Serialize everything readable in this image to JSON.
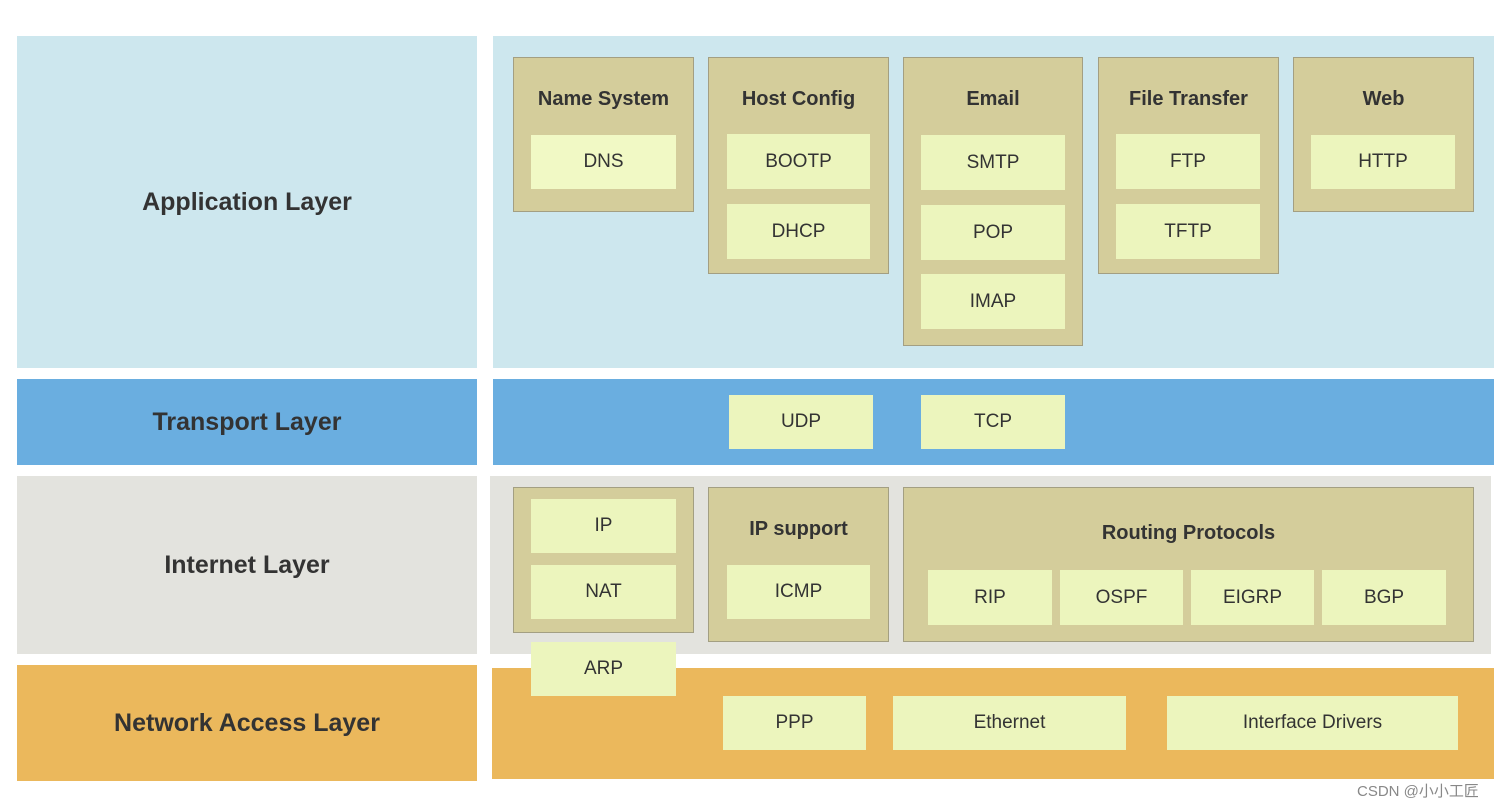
{
  "layers": {
    "application": "Application Layer",
    "transport": "Transport Layer",
    "internet": "Internet Layer",
    "network_access": "Network Access Layer"
  },
  "groups": {
    "name_system": "Name System",
    "host_config": "Host Config",
    "email": "Email",
    "file_transfer": "File Transfer",
    "web": "Web",
    "ip_support": "IP support",
    "routing": "Routing Protocols"
  },
  "protocols": {
    "dns": "DNS",
    "bootp": "BOOTP",
    "dhcp": "DHCP",
    "smtp": "SMTP",
    "pop": "POP",
    "imap": "IMAP",
    "ftp": "FTP",
    "tftp": "TFTP",
    "http": "HTTP",
    "udp": "UDP",
    "tcp": "TCP",
    "ip": "IP",
    "nat": "NAT",
    "icmp": "ICMP",
    "rip": "RIP",
    "ospf": "OSPF",
    "eigrp": "EIGRP",
    "bgp": "BGP",
    "arp": "ARP",
    "ppp": "PPP",
    "ethernet": "Ethernet",
    "interface_drivers": "Interface Drivers"
  },
  "watermark": "CSDN @小小工匠",
  "colors": {
    "application": "#cde7ee",
    "transport": "#6aaee0",
    "internet": "#e3e3de",
    "network_access": "#ebb85c",
    "group": "#d4cd9b",
    "protocol": "#ecf5bd"
  }
}
